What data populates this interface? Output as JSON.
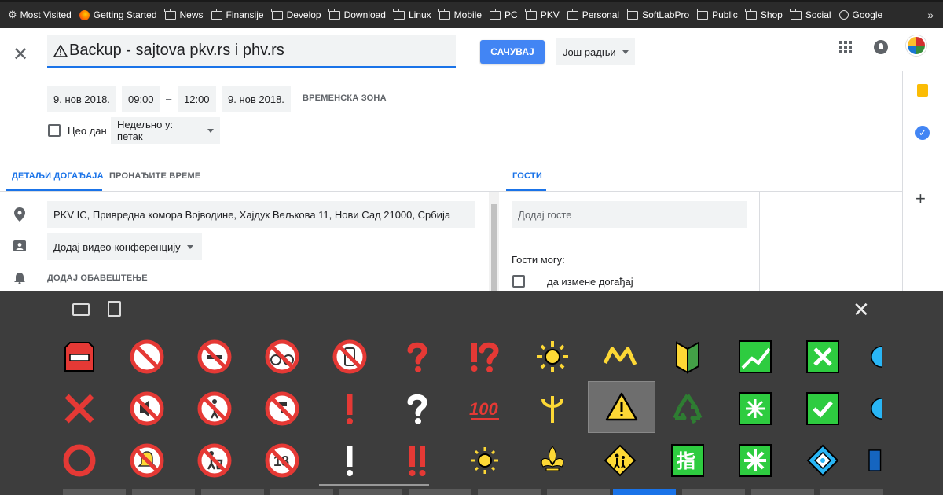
{
  "bookmarks": [
    {
      "label": "Most Visited",
      "icon": "gear-icon"
    },
    {
      "label": "Getting Started",
      "icon": "firefox-icon"
    },
    {
      "label": "News",
      "icon": "folder-icon"
    },
    {
      "label": "Finansije",
      "icon": "folder-icon"
    },
    {
      "label": "Develop",
      "icon": "folder-icon"
    },
    {
      "label": "Download",
      "icon": "folder-icon"
    },
    {
      "label": "Linux",
      "icon": "folder-icon"
    },
    {
      "label": "Mobile",
      "icon": "folder-icon"
    },
    {
      "label": "PC",
      "icon": "folder-icon"
    },
    {
      "label": "PKV",
      "icon": "folder-icon"
    },
    {
      "label": "Personal",
      "icon": "folder-icon"
    },
    {
      "label": "SoftLabPro",
      "icon": "folder-icon"
    },
    {
      "label": "Public",
      "icon": "folder-icon"
    },
    {
      "label": "Shop",
      "icon": "folder-icon"
    },
    {
      "label": "Social",
      "icon": "folder-icon"
    },
    {
      "label": "Google",
      "icon": "globe-icon"
    }
  ],
  "event": {
    "title": "Backup - sajtova pkv.rs i phv.rs",
    "save_label": "САЧУВАЈ",
    "more_actions": "Још радњи",
    "start_date": "9. нов 2018.",
    "start_time": "09:00",
    "dash": "–",
    "end_time": "12:00",
    "end_date": "9. нов 2018.",
    "timezone": "ВРЕМЕНСКА ЗОНА",
    "all_day": "Цео дан",
    "recurrence": "Недељно у: петак"
  },
  "tabs": {
    "details": "ДЕТАЉИ ДОГАЂАЈА",
    "find_time": "ПРОНАЂИТЕ ВРЕМЕ",
    "guests": "ГОСТИ"
  },
  "details": {
    "location": "PKV IC, Привредна комора Војводине, Хајдук Вељкова 11, Нови Сад 21000, Србија",
    "video": "Додај видео-конференцију",
    "notification": "ДОДАЈ ОБАВЕШТЕЊЕ"
  },
  "guests": {
    "placeholder": "Додај госте",
    "can_label": "Гости могу:",
    "modify": "да измене догађај"
  },
  "emoji_panel": {
    "selected": "warning-sign",
    "rows": [
      [
        "no-entry",
        "prohibited",
        "no-littering",
        "no-bicycles",
        "no-mobile-phones",
        "question-mark",
        "exclamation-question-mark",
        "bright-button",
        "part-alternation-mark",
        "japanese-beginner",
        "chart-yen",
        "cross-mark-button",
        "partial"
      ],
      [
        "cross-mark",
        "muted-speaker",
        "no-pedestrians",
        "non-potable-water",
        "exclamation-mark",
        "white-question-mark",
        "hundred-points",
        "trident",
        "warning-sign",
        "recycling",
        "eight-spoked-asterisk",
        "check-mark-button",
        "partial"
      ],
      [
        "hollow-red-circle",
        "bell-with-slash",
        "litter-in-bin",
        "no-one-under-eighteen",
        "white-exclamation-mark",
        "double-exclamation-mark",
        "dim-button",
        "fleur-de-lis",
        "children-crossing",
        "japanese-finger-button",
        "eight-spoked-asterisk-alt",
        "diamond-with-dot",
        "partial"
      ]
    ]
  }
}
